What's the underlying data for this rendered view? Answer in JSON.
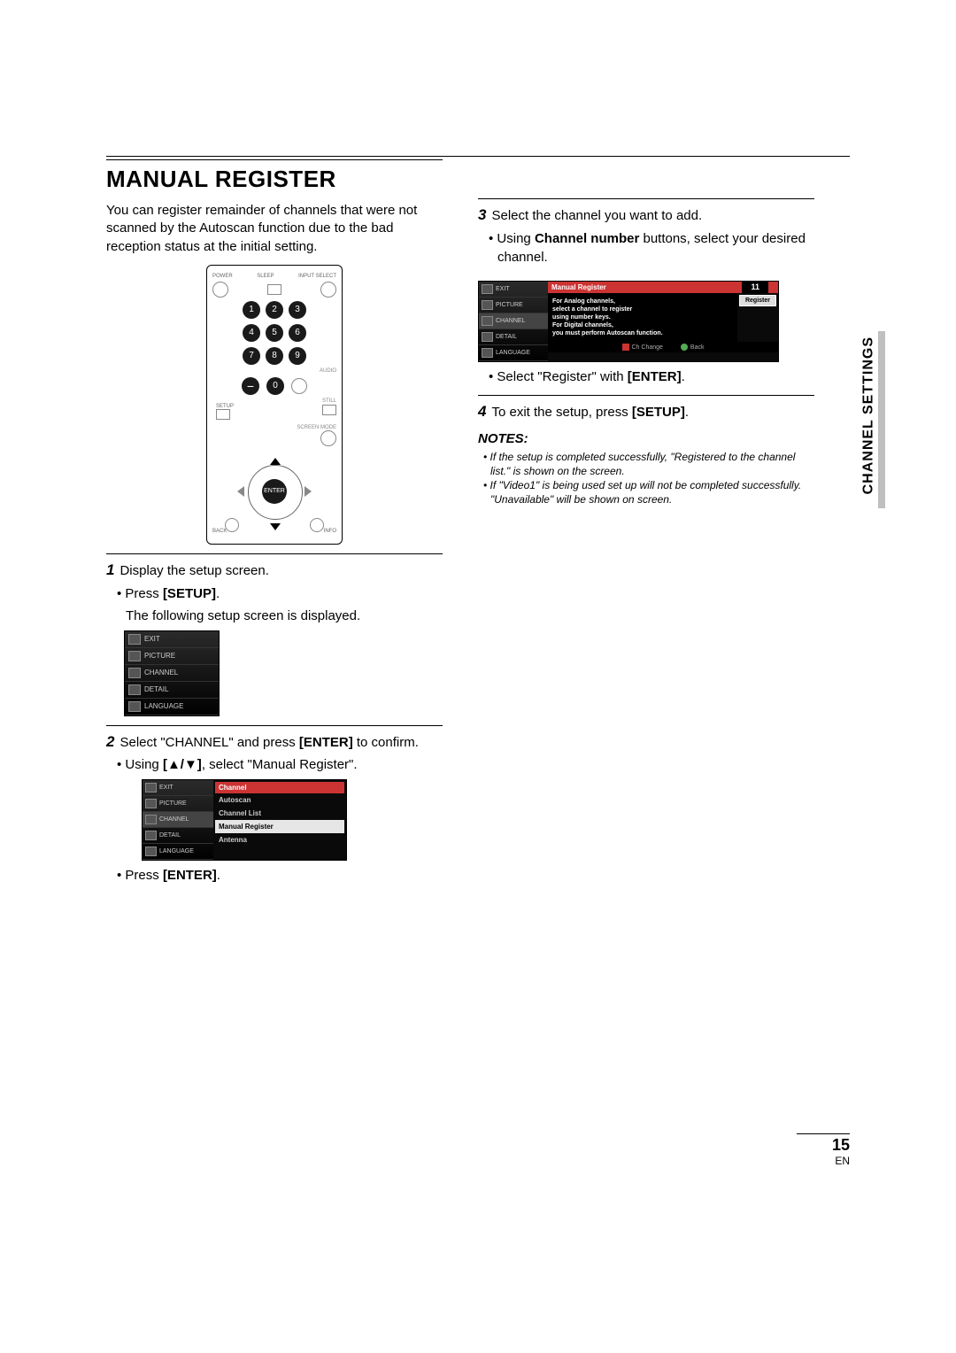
{
  "section_title": "MANUAL REGISTER",
  "intro": "You can register remainder of channels that were not scanned by the Autoscan function due to the bad reception status at the initial setting.",
  "side_tab": "CHANNEL SETTINGS",
  "page_number": "15",
  "page_lang": "EN",
  "remote": {
    "power": "POWER",
    "sleep": "SLEEP",
    "input": "INPUT SELECT",
    "audio": "AUDIO",
    "still": "STILL",
    "setup": "SETUP",
    "screen": "SCREEN MODE",
    "enter": "ENTER",
    "back": "BACK",
    "info": "INFO",
    "keys": [
      "1",
      "2",
      "3",
      "4",
      "5",
      "6",
      "7",
      "8",
      "9",
      "−",
      "0"
    ]
  },
  "steps": {
    "s1": {
      "num": "1",
      "text": "Display the setup screen."
    },
    "s1_b1_pre": "Press ",
    "s1_b1_key": "[SETUP]",
    "s1_b1_post": ".",
    "s1_line2": "The following setup screen is displayed.",
    "s2_num": "2",
    "s2_pre": "Select \"CHANNEL\" and press ",
    "s2_key": "[ENTER]",
    "s2_post": " to confirm.",
    "s2_b1_pre": "Using ",
    "s2_b1_key": "[▲/▼]",
    "s2_b1_post": ", select \"Manual Register\".",
    "s2_b2_pre": "Press ",
    "s2_b2_key": "[ENTER]",
    "s2_b2_post": ".",
    "s3_num": "3",
    "s3_text": "Select the channel you want to add.",
    "s3_b1_pre": "Using ",
    "s3_b1_key": "Channel number",
    "s3_b1_post": " buttons, select your desired channel.",
    "s3_b2_pre": "Select \"Register\" with ",
    "s3_b2_key": "[ENTER]",
    "s3_b2_post": ".",
    "s4_num": "4",
    "s4_pre": "To exit the setup, press ",
    "s4_key": "[SETUP]",
    "s4_post": "."
  },
  "notes_heading": "NOTES:",
  "notes": {
    "n1": "If the setup is completed successfully, \"Registered to the channel list.\" is shown on the screen.",
    "n2": "If \"Video1\" is being used set up will not be completed successfully. \"Unavailable\" will be shown on screen."
  },
  "osd": {
    "menu_items": [
      "EXIT",
      "PICTURE",
      "CHANNEL",
      "DETAIL",
      "LANGUAGE"
    ],
    "channel_hdr": "Channel",
    "channel_opts": [
      "Autoscan",
      "Channel List",
      "Manual Register",
      "Antenna"
    ],
    "mr_hdr": "Manual Register",
    "mr_badge": "11",
    "mr_msg_l1": "For Analog channels,",
    "mr_msg_l2": "select a channel to register",
    "mr_msg_l3": "using number keys.",
    "mr_msg_l4": "For Digital channels,",
    "mr_msg_l5": "you must perform Autoscan function.",
    "mr_register": "Register",
    "mr_foot1": "Ch Change",
    "mr_foot2": "Back"
  }
}
